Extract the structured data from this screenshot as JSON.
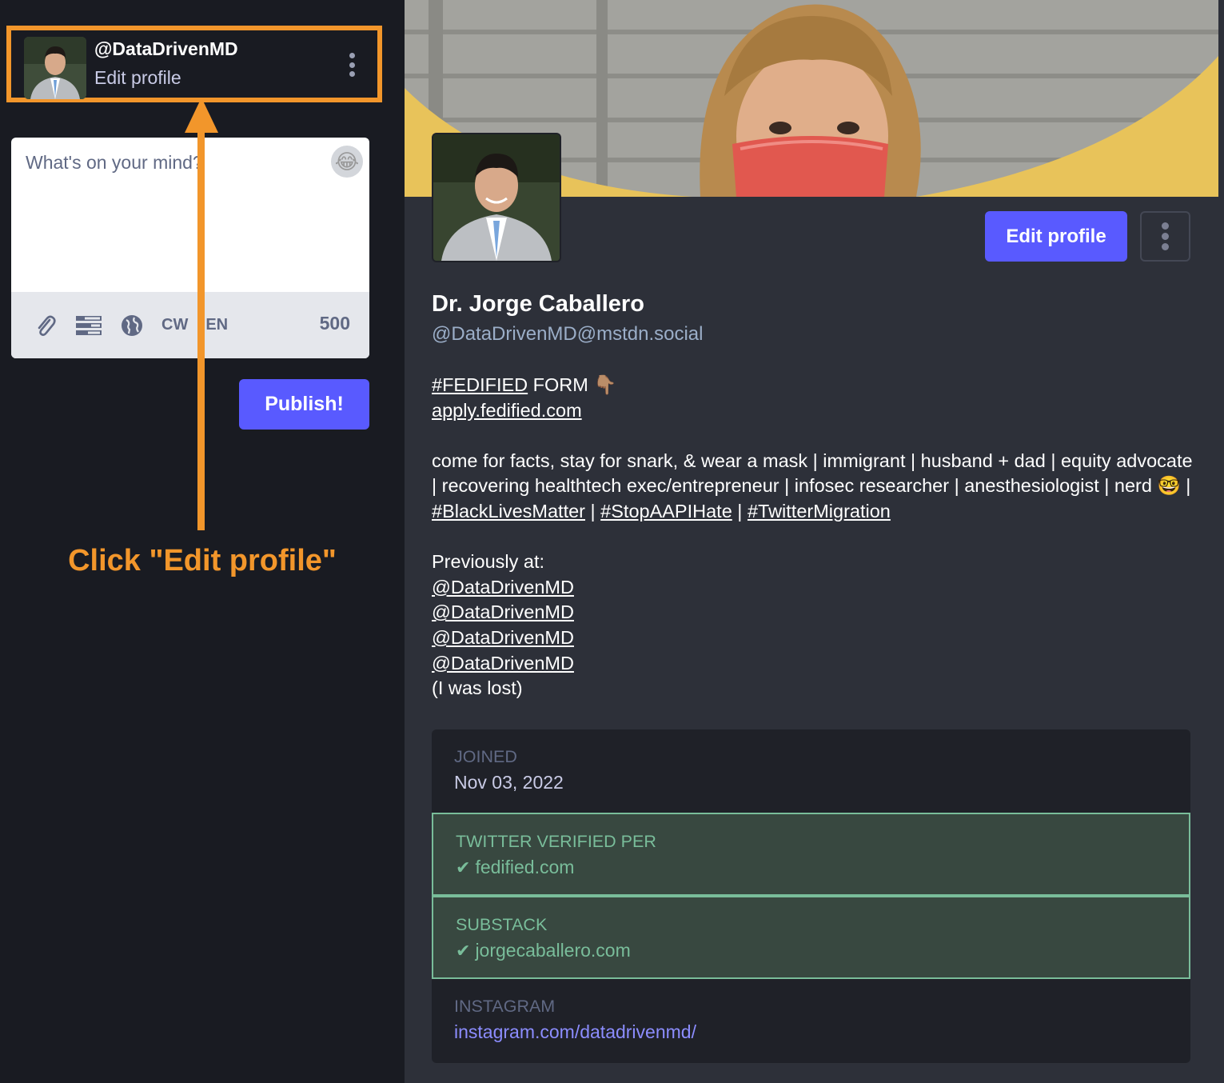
{
  "account": {
    "handle": "@DataDrivenMD",
    "edit_profile_label": "Edit profile"
  },
  "compose": {
    "placeholder": "What's on your mind?",
    "cw_label": "CW",
    "language": "EN",
    "char_count": "500",
    "publish_label": "Publish!"
  },
  "annotation": {
    "callout": "Click \"Edit profile\"",
    "color": "#f2962b"
  },
  "profile": {
    "display_name": "Dr. Jorge Caballero",
    "acct": "@DataDrivenMD@mstdn.social",
    "edit_button": "Edit profile",
    "bio": {
      "hashtag_fedified": "#FEDIFIED",
      "form_text": " FORM 👇🏽",
      "apply_link": "apply.fedified.com",
      "line1": "come for facts, stay for snark, & wear a mask | immigrant | husband + dad | equity advocate | recovering healthtech exec/entrepreneur | infosec researcher | anesthesiologist | nerd 🤓 | ",
      "tag_blm": "#BlackLivesMatter",
      "sep": " | ",
      "tag_aapi": "#StopAAPIHate",
      "tag_migration": "#TwitterMigration",
      "previously": "Previously at:",
      "mentions": [
        "@DataDrivenMD",
        "@DataDrivenMD",
        "@DataDrivenMD",
        "@DataDrivenMD"
      ],
      "lost": "(I was lost)"
    },
    "fields": {
      "joined_name": "JOINED",
      "joined_value": "Nov 03, 2022",
      "twitter_name": "TWITTER VERIFIED PER",
      "twitter_value": "fedified.com",
      "substack_name": "SUBSTACK",
      "substack_value": "jorgecaballero.com",
      "instagram_name": "INSTAGRAM",
      "instagram_value": "instagram.com/datadrivenmd/"
    }
  },
  "colors": {
    "accent": "#595aff",
    "verified": "#79bd9a",
    "annotation": "#f2962b"
  }
}
